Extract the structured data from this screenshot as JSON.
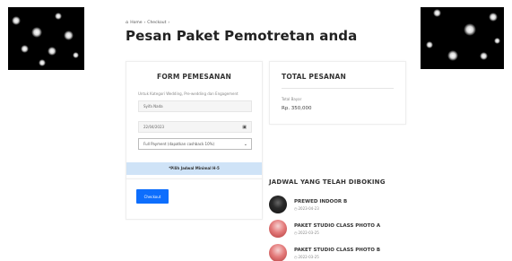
{
  "breadcrumb": {
    "home_icon": "home-icon",
    "items": [
      "Home",
      "Checkout"
    ],
    "separator": "›"
  },
  "page_title": "Pesan Paket Pemotretan anda",
  "form": {
    "title": "FORM PEMESANAN",
    "hint": "Untuk Kategori Wedding, Pre-wedding dan Engagement",
    "name_value": "Syifa Nada",
    "date_value": "22/04/2023",
    "payment_selected": "Full Payment (dapatkan cashback 10%)",
    "notice": "*Pilih Jadwal Minimal H-5"
  },
  "checkout": {
    "button_label": "Checkout"
  },
  "total": {
    "title": "TOTAL PESANAN",
    "label": "Total Bayar",
    "value": "Rp. 350,000"
  },
  "schedule": {
    "title": "JADWAL YANG TELAH DIBOKING",
    "items": [
      {
        "name": "PREWED INDOOR B",
        "date": "2023-04-23"
      },
      {
        "name": "PAKET STUDIO CLASS PHOTO A",
        "date": "2022-03-25"
      },
      {
        "name": "PAKET STUDIO CLASS PHOTO B",
        "date": "2022-03-25"
      }
    ]
  },
  "colors": {
    "accent": "#0d6efd",
    "notice_bg": "#cfe3f7"
  }
}
